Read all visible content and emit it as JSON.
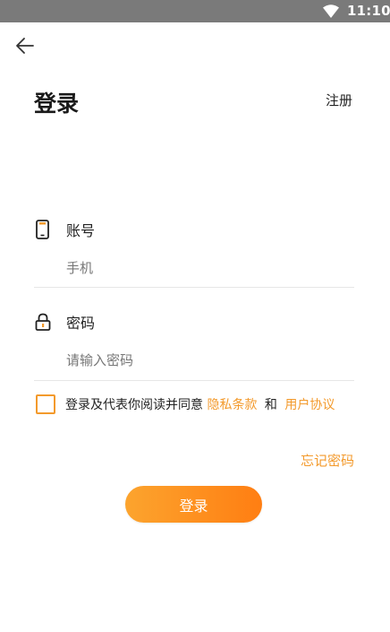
{
  "status_bar": {
    "time": "11:10",
    "wifi_icon": "wifi-icon"
  },
  "header": {
    "back_icon": "arrow-left-icon",
    "title": "登录",
    "register_label": "注册"
  },
  "form": {
    "account": {
      "icon": "phone-icon",
      "label": "账号",
      "placeholder": "手机",
      "value": ""
    },
    "password": {
      "icon": "lock-icon",
      "label": "密码",
      "placeholder": "请输入密码",
      "value": ""
    }
  },
  "agreement": {
    "checked": false,
    "prefix": "登录及代表你阅读并同意",
    "privacy_link": "隐私条款",
    "conjunction": "和",
    "user_agreement_link": "用户协议"
  },
  "forgot_password": "忘记密码",
  "login_button": "登录",
  "colors": {
    "accent": "#f39a2c",
    "button_start": "#fca42e",
    "button_end": "#ff7e12",
    "status_bar": "#7a7a7a"
  }
}
